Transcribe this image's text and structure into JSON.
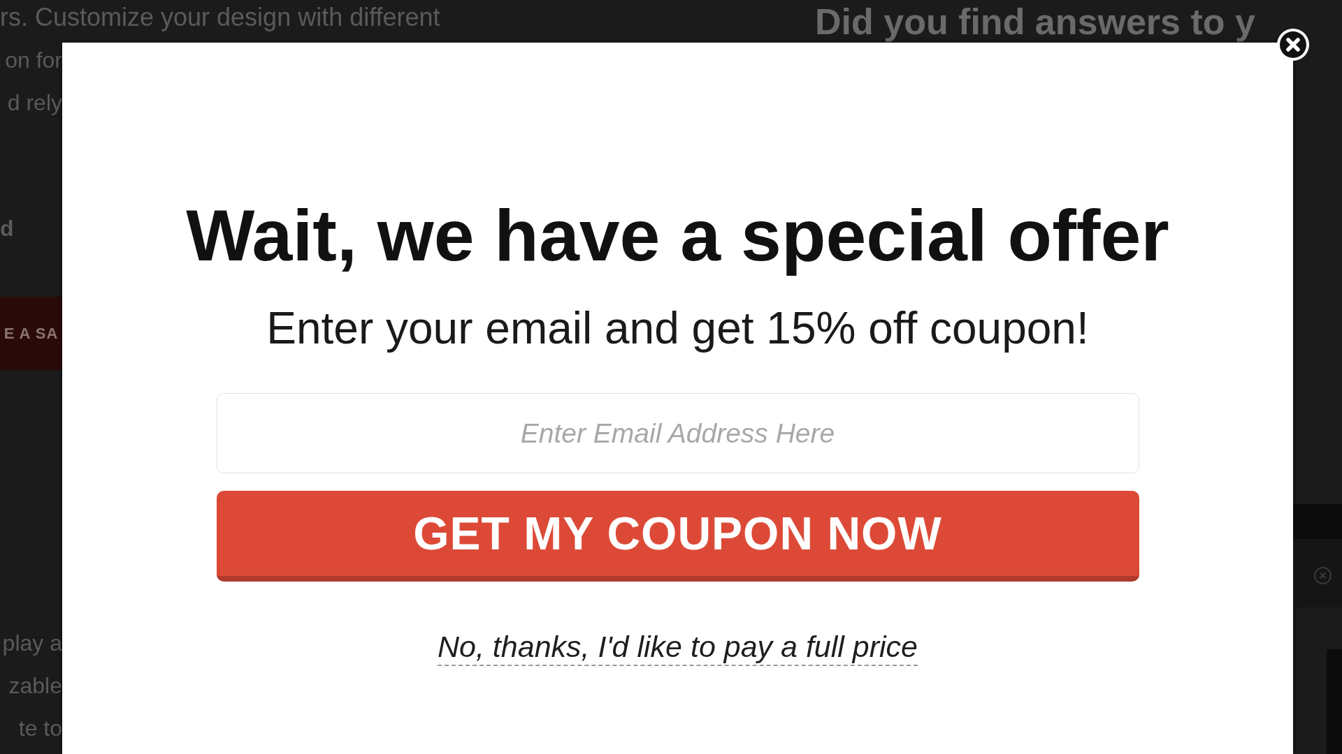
{
  "background_page": {
    "intro_line": "rs. Customize your design with different",
    "question_heading": "Did you find answers to y",
    "left_fragments_top": [
      "on for",
      "d rely"
    ],
    "left_label": "d",
    "left_button": "E A SA",
    "left_fragments_bottom": [
      "play a",
      "zable",
      "te to"
    ]
  },
  "popup": {
    "title": "Wait, we have a special offer",
    "subtitle": "Enter your email and get 15% off coupon!",
    "email_field": {
      "placeholder": "Enter Email Address Here"
    },
    "submit_button": "GET MY COUPON NOW",
    "decline_link": "No, thanks, I'd like to pay a full price"
  }
}
